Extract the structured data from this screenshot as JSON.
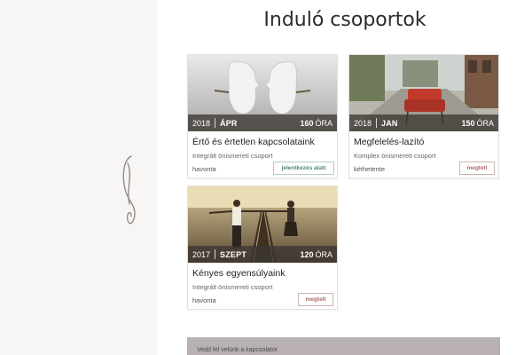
{
  "page": {
    "title": "Induló csoportok"
  },
  "cards": [
    {
      "year": "2018",
      "month": "ÁPR",
      "hours": "160",
      "hours_unit": "ÓRA",
      "title": "Értő és értetlen kapcsolataink",
      "subtitle": "Integrált önismereti csoport",
      "frequency": "havonta",
      "button": "jelentkezés alatt",
      "button_color": "#4e8a6a"
    },
    {
      "year": "2018",
      "month": "JAN",
      "hours": "150",
      "hours_unit": "ÓRA",
      "title": "Megfelelés-lazító",
      "subtitle": "Komplex önismereti csoport",
      "frequency": "kéthetente",
      "button": "megtelt",
      "button_color": "#b06a66"
    },
    {
      "year": "2017",
      "month": "SZEPT",
      "hours": "120",
      "hours_unit": "ÓRA",
      "title": "Kényes egyensúlyaink",
      "subtitle": "Integrált önismereti csoport",
      "frequency": "havonta",
      "button": "megtelt",
      "button_color": "#b06a66"
    }
  ],
  "footer": {
    "text": "Vedd fel velünk a kapcsolatot"
  },
  "colors": {
    "left_panel": "#f8f6f4",
    "footer_bg": "#b8b0b1",
    "bar_overlay": "#3c3732"
  }
}
